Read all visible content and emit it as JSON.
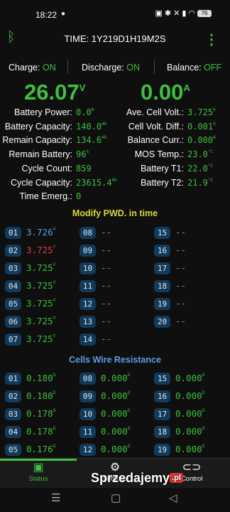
{
  "status_bar": {
    "time": "18:22",
    "battery": "76"
  },
  "header": {
    "title": "TIME: 1Y219D1H19M2S"
  },
  "toggles": [
    {
      "label": "Charge:",
      "value": "ON"
    },
    {
      "label": "Discharge:",
      "value": "ON"
    },
    {
      "label": "Balance:",
      "value": "OFF"
    }
  ],
  "big": {
    "voltage": "26.07",
    "voltage_unit": "V",
    "current": "0.00",
    "current_unit": "A"
  },
  "left_stats": [
    {
      "label": "Battery Power:",
      "value": "0.0",
      "unit": "W"
    },
    {
      "label": "Battery Capacity:",
      "value": "140.0",
      "unit": "Ah"
    },
    {
      "label": "Remain Capacity:",
      "value": "134.6",
      "unit": "Ah"
    },
    {
      "label": "Remain Battery:",
      "value": "96",
      "unit": "%"
    },
    {
      "label": "Cycle Count:",
      "value": "859",
      "unit": ""
    },
    {
      "label": "Cycle Capacity:",
      "value": "23615.4",
      "unit": "Ah"
    },
    {
      "label": "Time Emerg.:",
      "value": "0",
      "unit": ""
    }
  ],
  "right_stats": [
    {
      "label": "Ave. Cell Volt.:",
      "value": "3.725",
      "unit": "V"
    },
    {
      "label": "Cell Volt. Diff.:",
      "value": "0.001",
      "unit": "V"
    },
    {
      "label": "Balance Curr.:",
      "value": "0.000",
      "unit": "A"
    },
    {
      "label": "MOS Temp.:",
      "value": "23.0",
      "unit": "°C"
    },
    {
      "label": "Battery T1:",
      "value": "22.0",
      "unit": "°C"
    },
    {
      "label": "Battery T2:",
      "value": "21.9",
      "unit": "°C"
    }
  ],
  "section_voltages": {
    "title": "Modify PWD. in time"
  },
  "cell_voltages": [
    {
      "num": "01",
      "value": "3.726",
      "unit": "V",
      "color": "#4fa3e8"
    },
    {
      "num": "02",
      "value": "3.725",
      "unit": "V",
      "color": "#e23b3b"
    },
    {
      "num": "03",
      "value": "3.725",
      "unit": "V",
      "color": "#3fbf3f"
    },
    {
      "num": "04",
      "value": "3.725",
      "unit": "V",
      "color": "#3fbf3f"
    },
    {
      "num": "05",
      "value": "3.725",
      "unit": "V",
      "color": "#3fbf3f"
    },
    {
      "num": "06",
      "value": "3.725",
      "unit": "V",
      "color": "#3fbf3f"
    },
    {
      "num": "07",
      "value": "3.725",
      "unit": "V",
      "color": "#3fbf3f"
    },
    {
      "num": "08",
      "value": "--",
      "unit": "",
      "color": "#3fbf3f"
    },
    {
      "num": "09",
      "value": "--",
      "unit": "",
      "color": "#3fbf3f"
    },
    {
      "num": "10",
      "value": "--",
      "unit": "",
      "color": "#3fbf3f"
    },
    {
      "num": "11",
      "value": "--",
      "unit": "",
      "color": "#3fbf3f"
    },
    {
      "num": "12",
      "value": "--",
      "unit": "",
      "color": "#3fbf3f"
    },
    {
      "num": "13",
      "value": "--",
      "unit": "",
      "color": "#3fbf3f"
    },
    {
      "num": "14",
      "value": "--",
      "unit": "",
      "color": "#3fbf3f"
    },
    {
      "num": "15",
      "value": "--",
      "unit": "",
      "color": "#3fbf3f"
    },
    {
      "num": "16",
      "value": "--",
      "unit": "",
      "color": "#3fbf3f"
    },
    {
      "num": "17",
      "value": "--",
      "unit": "",
      "color": "#3fbf3f"
    },
    {
      "num": "18",
      "value": "--",
      "unit": "",
      "color": "#3fbf3f"
    },
    {
      "num": "19",
      "value": "--",
      "unit": "",
      "color": "#3fbf3f"
    },
    {
      "num": "20",
      "value": "--",
      "unit": "",
      "color": "#3fbf3f"
    }
  ],
  "section_resistance": {
    "title": "Cells Wire Resistance"
  },
  "wire_resistance": [
    {
      "num": "01",
      "value": "0.180",
      "unit": "Ω"
    },
    {
      "num": "02",
      "value": "0.180",
      "unit": "Ω"
    },
    {
      "num": "03",
      "value": "0.178",
      "unit": "Ω"
    },
    {
      "num": "04",
      "value": "0.178",
      "unit": "Ω"
    },
    {
      "num": "05",
      "value": "0.176",
      "unit": "Ω"
    },
    {
      "num": "08",
      "value": "0.000",
      "unit": "Ω"
    },
    {
      "num": "09",
      "value": "0.000",
      "unit": "Ω"
    },
    {
      "num": "10",
      "value": "0.000",
      "unit": "Ω"
    },
    {
      "num": "11",
      "value": "0.000",
      "unit": "Ω"
    },
    {
      "num": "12",
      "value": "0.000",
      "unit": "Ω"
    },
    {
      "num": "15",
      "value": "0.000",
      "unit": "Ω"
    },
    {
      "num": "16",
      "value": "0.000",
      "unit": "Ω"
    },
    {
      "num": "17",
      "value": "0.000",
      "unit": "Ω"
    },
    {
      "num": "18",
      "value": "0.000",
      "unit": "Ω"
    },
    {
      "num": "19",
      "value": "0.000",
      "unit": "Ω"
    }
  ],
  "tabs": [
    {
      "label": "Status",
      "icon": "monitor-icon"
    },
    {
      "label": "Settings",
      "icon": "gear-icon"
    },
    {
      "label": "Control",
      "icon": "toggle-icon"
    }
  ],
  "watermark": {
    "text": "Sprzedajemy",
    "suffix": ".pl"
  }
}
